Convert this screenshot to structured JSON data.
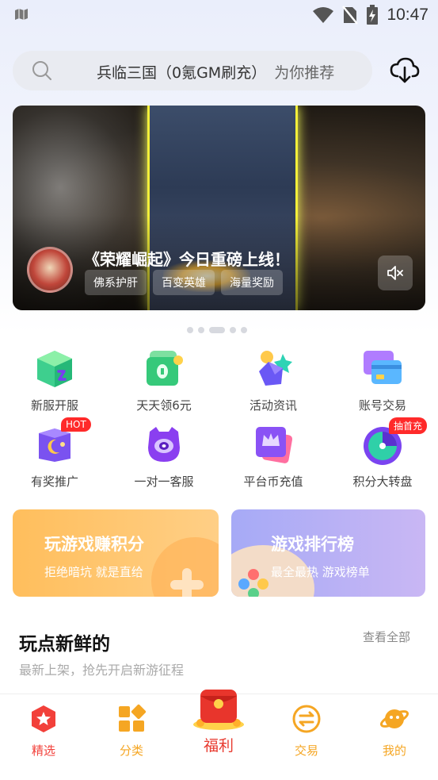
{
  "status_bar": {
    "time": "10:47"
  },
  "search": {
    "text": "兵临三国（0氪GM刷充）",
    "suffix": "为你推荐"
  },
  "banner": {
    "title": "《荣耀崛起》今日重磅上线！",
    "tags": [
      "佛系护肝",
      "百变英雄",
      "海量奖励"
    ],
    "page_count": 5,
    "active_page": 3
  },
  "grid": [
    {
      "label": "新服开服",
      "icon": "cube-icon"
    },
    {
      "label": "天天领6元",
      "icon": "cash-icon"
    },
    {
      "label": "活动资讯",
      "icon": "activity-icon"
    },
    {
      "label": "账号交易",
      "icon": "card-icon"
    },
    {
      "label": "有奖推广",
      "icon": "promo-icon",
      "badge": "HOT"
    },
    {
      "label": "一对一客服",
      "icon": "service-icon"
    },
    {
      "label": "平台币充值",
      "icon": "crown-icon"
    },
    {
      "label": "积分大转盘",
      "icon": "wheel-icon",
      "badge": "抽首充"
    }
  ],
  "cards": [
    {
      "title": "玩游戏赚积分",
      "subtitle": "拒绝暗坑 就是直给"
    },
    {
      "title": "游戏排行榜",
      "subtitle": "最全最热 游戏榜单"
    }
  ],
  "section": {
    "title": "玩点新鲜的",
    "subtitle": "最新上架，抢先开启新游征程",
    "more": "查看全部"
  },
  "nav": [
    {
      "label": "精选",
      "icon": "star-icon",
      "color": "#f2403a"
    },
    {
      "label": "分类",
      "icon": "category-icon",
      "color": "#f5a623"
    },
    {
      "label": "福利",
      "icon": "red-envelope-icon",
      "color": "#e83a2f"
    },
    {
      "label": "交易",
      "icon": "exchange-icon",
      "color": "#f5a623"
    },
    {
      "label": "我的",
      "icon": "planet-icon",
      "color": "#f5a623"
    }
  ],
  "colors": {
    "accent_orange": "#f5a623",
    "accent_red": "#f2403a",
    "badge_red": "#ff2a2a"
  }
}
